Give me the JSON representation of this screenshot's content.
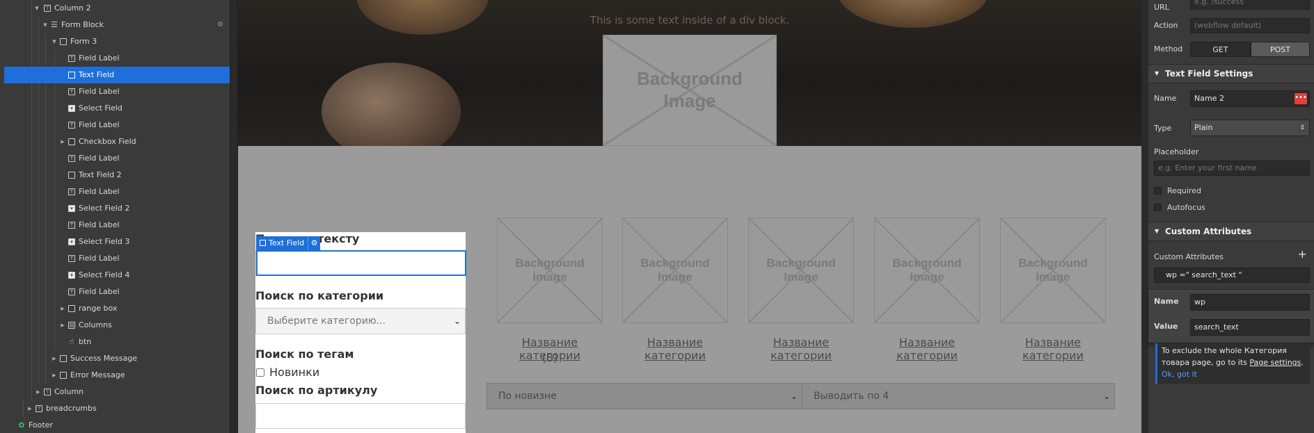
{
  "navigator": {
    "rows": [
      {
        "label": "Column 2",
        "icon": "column-icon"
      },
      {
        "label": "Form Block",
        "icon": "form-block-icon",
        "extra": "⚙"
      },
      {
        "label": "Form 3",
        "icon": "box-icon"
      },
      {
        "label": "Field Label",
        "icon": "field-label-icon"
      },
      {
        "label": "Text Field",
        "icon": "box-icon"
      },
      {
        "label": "Field Label",
        "icon": "field-label-icon"
      },
      {
        "label": "Select Field",
        "icon": "select-icon"
      },
      {
        "label": "Field Label",
        "icon": "field-label-icon"
      },
      {
        "label": "Checkbox Field",
        "icon": "box-icon"
      },
      {
        "label": "Field Label",
        "icon": "field-label-icon"
      },
      {
        "label": "Text Field 2",
        "icon": "box-icon"
      },
      {
        "label": "Field Label",
        "icon": "field-label-icon"
      },
      {
        "label": "Select Field 2",
        "icon": "select-icon"
      },
      {
        "label": "Field Label",
        "icon": "field-label-icon"
      },
      {
        "label": "Select Field 3",
        "icon": "select-icon"
      },
      {
        "label": "Field Label",
        "icon": "field-label-icon"
      },
      {
        "label": "Select Field 4",
        "icon": "select-icon"
      },
      {
        "label": "Field Label",
        "icon": "field-label-icon"
      },
      {
        "label": "range box",
        "icon": "box-icon"
      },
      {
        "label": "Columns",
        "icon": "columns-icon"
      },
      {
        "label": "btn",
        "icon": "pointer-icon"
      },
      {
        "label": "Success Message",
        "icon": "box-icon"
      },
      {
        "label": "Error Message",
        "icon": "box-icon"
      },
      {
        "label": "Column",
        "icon": "column-icon"
      },
      {
        "label": "breadcrumbs",
        "icon": "column-icon"
      },
      {
        "label": "Footer",
        "icon": "symbol-icon"
      }
    ]
  },
  "canvas": {
    "hero_text": "This is some text inside of a div block.",
    "bg_image_label_1": "Background",
    "bg_image_label_2": "Image",
    "categories": [
      {
        "title": "Название категории",
        "count": "(8)"
      },
      {
        "title": "Название категории"
      },
      {
        "title": "Название категории"
      },
      {
        "title": "Название категории"
      },
      {
        "title": "Название категории"
      }
    ],
    "form": {
      "search_text_heading": "Поиск по тексту",
      "selected_badge": "Text Field",
      "category_heading": "Поиск по категории",
      "category_select": "Выберите категорию...",
      "tags_heading": "Поиск по тегам",
      "tag_checkbox_label": "Новинки",
      "article_heading": "Поиск по артикулу"
    },
    "sort_select": "По новизне",
    "per_page_select": "Выводить по 4"
  },
  "settings": {
    "redirect_url_label": "URL",
    "redirect_url_placeholder": "e.g. /success",
    "action_label": "Action",
    "action_placeholder": "(webflow default)",
    "method_label": "Method",
    "method_get": "GET",
    "method_post": "POST",
    "method_selected": "POST",
    "text_field_settings_title": "Text Field Settings",
    "name_label": "Name",
    "name_value": "Name 2",
    "type_label": "Type",
    "type_value": "Plain",
    "placeholder_label": "Placeholder",
    "placeholder_placeholder": "e.g. Enter your first name",
    "required_label": "Required",
    "autofocus_label": "Autofocus",
    "custom_attributes_title": "Custom Attributes",
    "custom_attributes_label": "Custom Attributes",
    "attribute_summary": "wp =\" search_text \"",
    "attr_name_label": "Name",
    "attr_name_value": "wp",
    "attr_value_label": "Value",
    "attr_value_value": "search_text",
    "tip_line1": "To exclude the whole Категория",
    "tip_line2_pre": "товара page, go to its ",
    "tip_link": "Page settings",
    "tip_line2_post": ".",
    "tip_ok": "Ok, got it",
    "accent_color": "#1e6fd9"
  }
}
